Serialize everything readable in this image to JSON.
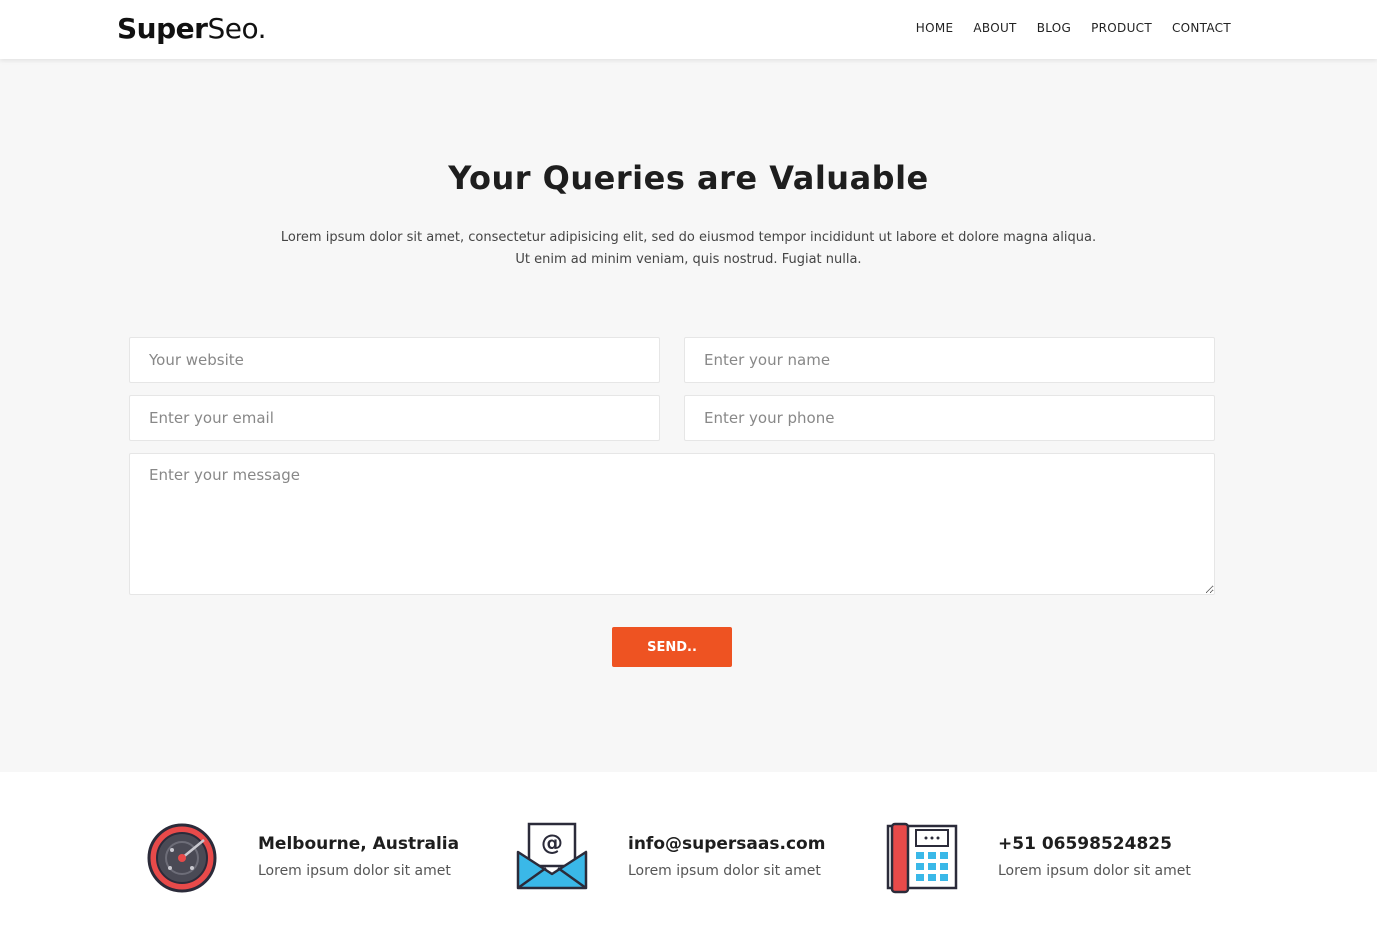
{
  "header": {
    "logo_bold": "Super",
    "logo_light": "Seo.",
    "nav": [
      "HOME",
      "ABOUT",
      "BLOG",
      "PRODUCT",
      "CONTACT"
    ]
  },
  "main": {
    "title": "Your Queries are Valuable",
    "desc_line1": "Lorem ipsum dolor sit amet, consectetur adipisicing elit, sed do eiusmod tempor incididunt ut labore et dolore magna aliqua.",
    "desc_line2": "Ut enim ad minim veniam, quis nostrud. Fugiat nulla."
  },
  "form": {
    "website_placeholder": "Your website",
    "name_placeholder": "Enter your name",
    "email_placeholder": "Enter your email",
    "phone_placeholder": "Enter your phone",
    "message_placeholder": "Enter your message",
    "send_label": "SEND.."
  },
  "footer": {
    "items": [
      {
        "icon": "radar-icon",
        "headline": "Melbourne, Australia",
        "sub": "Lorem ipsum dolor sit amet"
      },
      {
        "icon": "email-envelope-icon",
        "headline": "info@supersaas.com",
        "sub": "Lorem ipsum dolor sit amet"
      },
      {
        "icon": "telephone-icon",
        "headline": "+51 06598524825",
        "sub": "Lorem ipsum dolor sit amet"
      }
    ]
  },
  "colors": {
    "accent": "#ee5322",
    "background": "#f7f7f7",
    "icon_red": "#e84a4a",
    "icon_blue": "#3ab8e8"
  }
}
